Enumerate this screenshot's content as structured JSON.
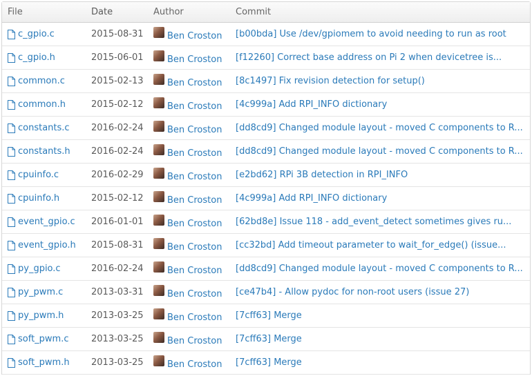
{
  "header": {
    "file": "File",
    "date": "Date",
    "author": "Author",
    "commit": "Commit"
  },
  "rows": [
    {
      "file": "c_gpio.c",
      "date": "2015-08-31",
      "author": "Ben Croston",
      "commit": "[b00bda] Use /dev/gpiomem to avoid needing to run as root"
    },
    {
      "file": "c_gpio.h",
      "date": "2015-06-01",
      "author": "Ben Croston",
      "commit": "[f12260] Correct base address on Pi 2 when devicetree is..."
    },
    {
      "file": "common.c",
      "date": "2015-02-13",
      "author": "Ben Croston",
      "commit": "[8c1497] Fix revision detection for setup()"
    },
    {
      "file": "common.h",
      "date": "2015-02-12",
      "author": "Ben Croston",
      "commit": "[4c999a] Add RPI_INFO dictionary"
    },
    {
      "file": "constants.c",
      "date": "2016-02-24",
      "author": "Ben Croston",
      "commit": "[dd8cd9] Changed module layout - moved C components to R..."
    },
    {
      "file": "constants.h",
      "date": "2016-02-24",
      "author": "Ben Croston",
      "commit": "[dd8cd9] Changed module layout - moved C components to R..."
    },
    {
      "file": "cpuinfo.c",
      "date": "2016-02-29",
      "author": "Ben Croston",
      "commit": "[e2bd62] RPi 3B detection in RPI_INFO"
    },
    {
      "file": "cpuinfo.h",
      "date": "2015-02-12",
      "author": "Ben Croston",
      "commit": "[4c999a] Add RPI_INFO dictionary"
    },
    {
      "file": "event_gpio.c",
      "date": "2016-01-01",
      "author": "Ben Croston",
      "commit": "[62bd8e] Issue 118 - add_event_detect sometimes gives ru..."
    },
    {
      "file": "event_gpio.h",
      "date": "2015-08-31",
      "author": "Ben Croston",
      "commit": "[cc32bd] Add timeout parameter to wait_for_edge() (issue..."
    },
    {
      "file": "py_gpio.c",
      "date": "2016-02-24",
      "author": "Ben Croston",
      "commit": "[dd8cd9] Changed module layout - moved C components to R..."
    },
    {
      "file": "py_pwm.c",
      "date": "2013-03-31",
      "author": "Ben Croston",
      "commit": "[ce47b4] - Allow pydoc for non-root users (issue 27)"
    },
    {
      "file": "py_pwm.h",
      "date": "2013-03-25",
      "author": "Ben Croston",
      "commit": "[7cff63] Merge"
    },
    {
      "file": "soft_pwm.c",
      "date": "2013-03-25",
      "author": "Ben Croston",
      "commit": "[7cff63] Merge"
    },
    {
      "file": "soft_pwm.h",
      "date": "2013-03-25",
      "author": "Ben Croston",
      "commit": "[7cff63] Merge"
    }
  ],
  "icons": {
    "file": "file-icon",
    "avatar": "avatar"
  },
  "colors": {
    "link": "#2a7ab9",
    "border": "#e4e4e4"
  }
}
